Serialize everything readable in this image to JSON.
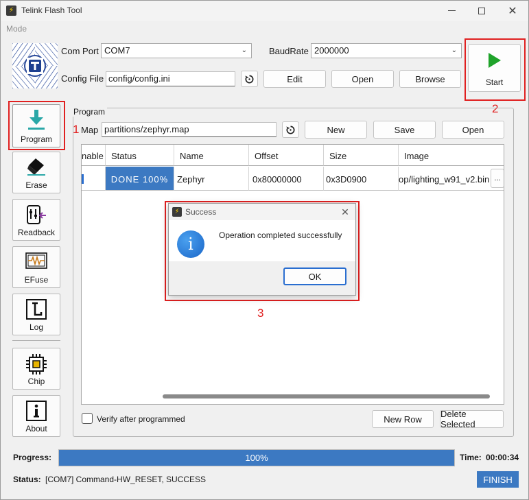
{
  "window": {
    "title": "Telink Flash Tool"
  },
  "menubar": {
    "mode": "Mode"
  },
  "connection": {
    "com_port_label": "Com Port",
    "com_port_value": "COM7",
    "baudrate_label": "BaudRate",
    "baudrate_value": "2000000",
    "config_file_label": "Config File",
    "config_file_value": "config/config.ini",
    "edit_label": "Edit",
    "open_label": "Open",
    "browse_label": "Browse"
  },
  "start": {
    "label": "Start"
  },
  "annotations": {
    "n1": "1",
    "n2": "2",
    "n3": "3"
  },
  "sidebar": {
    "items": [
      {
        "label": "Program",
        "icon": "download-icon"
      },
      {
        "label": "Erase",
        "icon": "eraser-icon"
      },
      {
        "label": "Readback",
        "icon": "readback-icon"
      },
      {
        "label": "EFuse",
        "icon": "fuse-icon"
      },
      {
        "label": "Log",
        "icon": "log-icon"
      },
      {
        "label": "Chip",
        "icon": "chip-icon"
      },
      {
        "label": "About",
        "icon": "info-icon"
      }
    ]
  },
  "program": {
    "group_title": "Program",
    "map_label": "Map",
    "map_value": "partitions/zephyr.map",
    "new_label": "New",
    "save_label": "Save",
    "open_label": "Open",
    "table": {
      "columns": [
        "nable",
        "Status",
        "Name",
        "Offset",
        "Size",
        "Image"
      ],
      "rows": [
        {
          "status": "DONE 100%",
          "name": "Zephyr",
          "offset": "0x80000000",
          "size": "0x3D0900",
          "image": "op/lighting_w91_v2.bin",
          "browse": "..."
        }
      ]
    },
    "verify_label": "Verify after programmed",
    "verify_checked": false,
    "new_row_label": "New Row",
    "delete_selected_label": "Delete Selected"
  },
  "progress": {
    "label": "Progress:",
    "value_text": "100%",
    "value": 1.0,
    "time_label": "Time:",
    "time_value": "00:00:34"
  },
  "status": {
    "label": "Status:",
    "text": "[COM7] Command-HW_RESET, SUCCESS",
    "finish": "FINISH"
  },
  "dialog": {
    "title": "Success",
    "message": "Operation completed successfully",
    "ok_label": "OK"
  },
  "colors": {
    "accent": "#3c79c2",
    "annotation_red": "#e02020",
    "start_green": "#1fa32a",
    "program_teal": "#2aa7a7"
  }
}
